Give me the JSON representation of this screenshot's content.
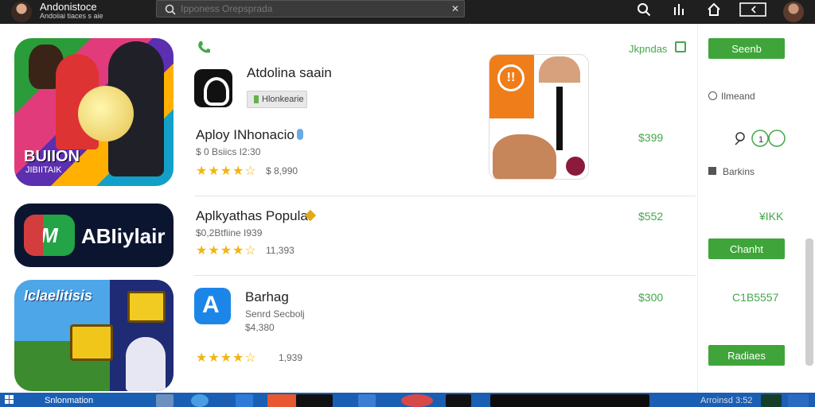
{
  "topbar": {
    "app_title": "Andonistoce",
    "app_subtitle": "Andoiiai tiaces s aie",
    "search_placeholder": "Ipponess Orepsprada",
    "icons": [
      "search-icon",
      "signal-icon",
      "home-icon",
      "window-icon",
      "avatar"
    ]
  },
  "listing": {
    "header_link": "Jkpndas",
    "phone_icon": "phone-icon",
    "items": [
      {
        "tile_title": "BUIION",
        "tile_subtitle": "JIBIITAIK",
        "name": "Atdolina saain",
        "tag": "Hlonkearie",
        "app_name": "Aploy INhonacio",
        "meta": "$ 0 Bsiics I2:30",
        "rating_text": "$ 8,990",
        "price": "$399",
        "button": "Seenb"
      },
      {
        "tile_name": "ABIiylair",
        "app_name": "Aplkyathas Popular",
        "meta": "$0,2Btfiine I939",
        "rating_text": "11,393",
        "price": "$552",
        "side_value": "¥IKK",
        "button": "Chanht"
      },
      {
        "tile_title": "Iclaelitisis",
        "app_name": "Barhag",
        "meta_line1": "Senrd Secbolj",
        "meta_line2": "$4,380",
        "rating_text": "1,939",
        "price": "$300",
        "side_value": "C1B5557",
        "button": "Radiaes"
      }
    ]
  },
  "sidebar": {
    "option1": "Ilmeand",
    "option3": "Barkins"
  },
  "taskbar": {
    "label": "Snlonmation",
    "right_text": "Arroinsd 3:52"
  }
}
